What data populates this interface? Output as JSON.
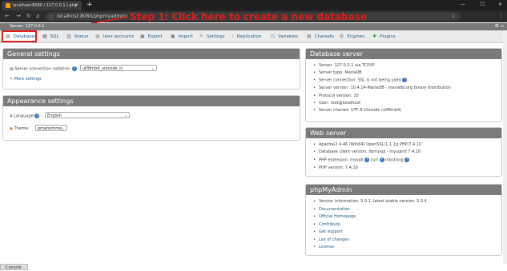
{
  "browser": {
    "tab_title": "localhost:8080 / 127.0.0.1 | php",
    "url": "localhost:8080/phpmyadmin/"
  },
  "annotation": {
    "text": "Step 1: Click here to create a new database",
    "color": "#d91f1f"
  },
  "breadcrumb": {
    "server": "Server: 127.0.0.1"
  },
  "topnav": [
    {
      "label": "Databases",
      "icon": "database-icon"
    },
    {
      "label": "SQL",
      "icon": "sql-icon"
    },
    {
      "label": "Status",
      "icon": "status-icon"
    },
    {
      "label": "User accounts",
      "icon": "users-icon"
    },
    {
      "label": "Export",
      "icon": "export-icon"
    },
    {
      "label": "Import",
      "icon": "import-icon"
    },
    {
      "label": "Settings",
      "icon": "wrench-icon"
    },
    {
      "label": "Replication",
      "icon": "replication-icon"
    },
    {
      "label": "Variables",
      "icon": "variables-icon"
    },
    {
      "label": "Charsets",
      "icon": "charsets-icon"
    },
    {
      "label": "Engines",
      "icon": "engines-icon"
    },
    {
      "label": "Plugins",
      "icon": "plugins-icon"
    }
  ],
  "general": {
    "title": "General settings",
    "collation_label": "Server connection collation:",
    "collation_value": "utf8mb4_unicode_ci",
    "more": "More settings"
  },
  "appearance": {
    "title": "Appearance settings",
    "language_label": "Language",
    "language_value": "English",
    "theme_label": "Theme:",
    "theme_value": "pmahomme"
  },
  "dbserver": {
    "title": "Database server",
    "items": [
      "Server: 127.0.0.1 via TCP/IP",
      "Server type: MariaDB",
      "Server connection: SSL is not being used",
      "Server version: 10.4.14-MariaDB - mariadb.org binary distribution",
      "Protocol version: 10",
      "User: root@localhost",
      "Server charset: UTF-8 Unicode (utf8mb4)"
    ]
  },
  "webserver": {
    "title": "Web server",
    "items": [
      "Apache/2.4.46 (Win64) OpenSSL/1.1.1g PHP/7.4.10",
      "Database client version: libmysql - mysqlnd 7.4.10",
      "PHP extension: mysqli",
      "PHP version: 7.4.10"
    ],
    "ext": [
      "curl",
      "mbstring"
    ]
  },
  "pma": {
    "title": "phpMyAdmin",
    "version": "Version information: 5.0.2, latest stable version: 5.0.4",
    "links": [
      "Documentation",
      "Official Homepage",
      "Contribute",
      "Get support",
      "List of changes",
      "License"
    ]
  },
  "console": {
    "label": "Console"
  }
}
